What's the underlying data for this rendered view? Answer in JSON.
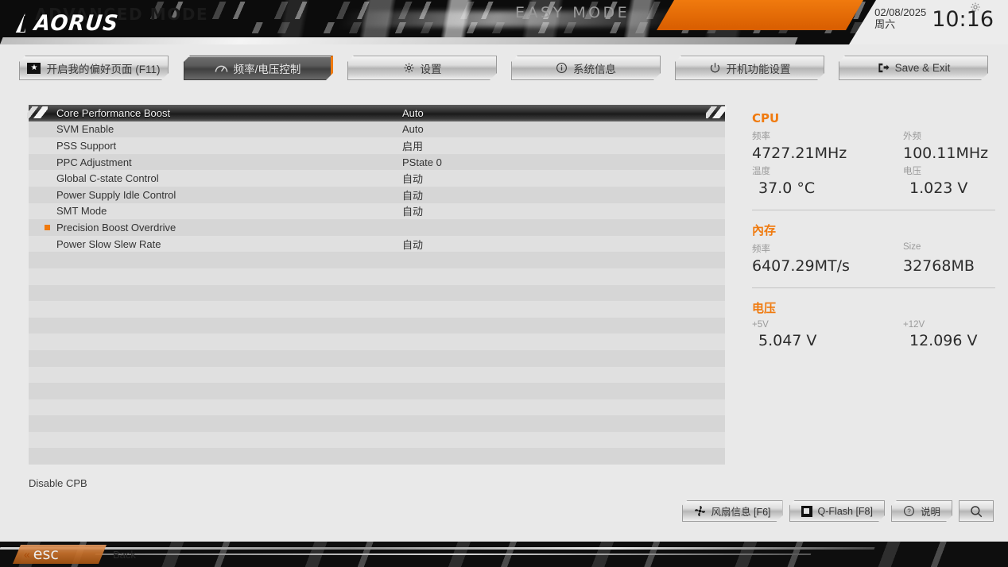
{
  "banner": {
    "brand": "AORUS",
    "easy_mode": "EASY MODE",
    "advanced_mode": "ADVANCED MODE",
    "date": "02/08/2025",
    "weekday": "周六",
    "time": "10:16",
    "gear_icon": "gear-icon"
  },
  "nav": {
    "tabs": [
      {
        "label": "开启我的偏好页面 (F11)",
        "icon": "star-box-icon",
        "active": false
      },
      {
        "label": "频率/电压控制",
        "icon": "gauge-icon",
        "active": true
      },
      {
        "label": "设置",
        "icon": "gear-icon",
        "active": false
      },
      {
        "label": "系统信息",
        "icon": "info-icon",
        "active": false
      },
      {
        "label": "开机功能设置",
        "icon": "power-icon",
        "active": false
      },
      {
        "label": "Save & Exit",
        "icon": "exit-icon",
        "active": false
      }
    ]
  },
  "settings": {
    "rows": [
      {
        "label": "Core Performance Boost",
        "value": "Auto",
        "selected": true,
        "bullet": false
      },
      {
        "label": "SVM Enable",
        "value": "Auto",
        "selected": false,
        "bullet": false
      },
      {
        "label": "PSS Support",
        "value": "启用",
        "selected": false,
        "bullet": false
      },
      {
        "label": "PPC Adjustment",
        "value": "PState 0",
        "selected": false,
        "bullet": false
      },
      {
        "label": "Global C-state Control",
        "value": "自动",
        "selected": false,
        "bullet": false
      },
      {
        "label": "Power Supply Idle Control",
        "value": "自动",
        "selected": false,
        "bullet": false
      },
      {
        "label": "SMT Mode",
        "value": "自动",
        "selected": false,
        "bullet": false
      },
      {
        "label": "Precision Boost Overdrive",
        "value": "",
        "selected": false,
        "bullet": true
      },
      {
        "label": "Power Slow Slew Rate",
        "value": "自动",
        "selected": false,
        "bullet": false
      },
      {
        "label": "",
        "value": "",
        "selected": false,
        "bullet": false
      },
      {
        "label": "",
        "value": "",
        "selected": false,
        "bullet": false
      },
      {
        "label": "",
        "value": "",
        "selected": false,
        "bullet": false
      },
      {
        "label": "",
        "value": "",
        "selected": false,
        "bullet": false
      },
      {
        "label": "",
        "value": "",
        "selected": false,
        "bullet": false
      },
      {
        "label": "",
        "value": "",
        "selected": false,
        "bullet": false
      },
      {
        "label": "",
        "value": "",
        "selected": false,
        "bullet": false
      },
      {
        "label": "",
        "value": "",
        "selected": false,
        "bullet": false
      },
      {
        "label": "",
        "value": "",
        "selected": false,
        "bullet": false
      },
      {
        "label": "",
        "value": "",
        "selected": false,
        "bullet": false
      },
      {
        "label": "",
        "value": "",
        "selected": false,
        "bullet": false
      },
      {
        "label": "",
        "value": "",
        "selected": false,
        "bullet": false
      },
      {
        "label": "",
        "value": "",
        "selected": false,
        "bullet": false
      }
    ],
    "help_text": "Disable CPB"
  },
  "sidebar": {
    "cpu": {
      "title": "CPU",
      "freq_key": "频率",
      "freq_val": "4727.21MHz",
      "bclk_key": "外频",
      "bclk_val": "100.11MHz",
      "temp_key": "温度",
      "temp_val": "37.0 °C",
      "volt_key": "电压",
      "volt_val": "1.023 V"
    },
    "memory": {
      "title": "內存",
      "freq_key": "频率",
      "freq_val": "6407.29MT/s",
      "size_key": "Size",
      "size_val": "32768MB"
    },
    "voltage": {
      "title": "电压",
      "v5_key": "+5V",
      "v5_val": "5.047 V",
      "v12_key": "+12V",
      "v12_val": "12.096 V"
    }
  },
  "bottom_buttons": [
    {
      "label": "风扇信息 [F6]",
      "icon": "fan-icon"
    },
    {
      "label": "Q-Flash [F8]",
      "icon": "qflash-icon"
    },
    {
      "label": "说明",
      "icon": "question-icon"
    },
    {
      "label": "",
      "icon": "search-icon"
    }
  ],
  "footer": {
    "esc_label": "esc",
    "back_label": "Back"
  },
  "colors": {
    "accent": "#f07a0e",
    "panel_bg": "#e9e9e9",
    "row_odd": "#e0e0e0",
    "row_even": "#d6d6d6"
  }
}
